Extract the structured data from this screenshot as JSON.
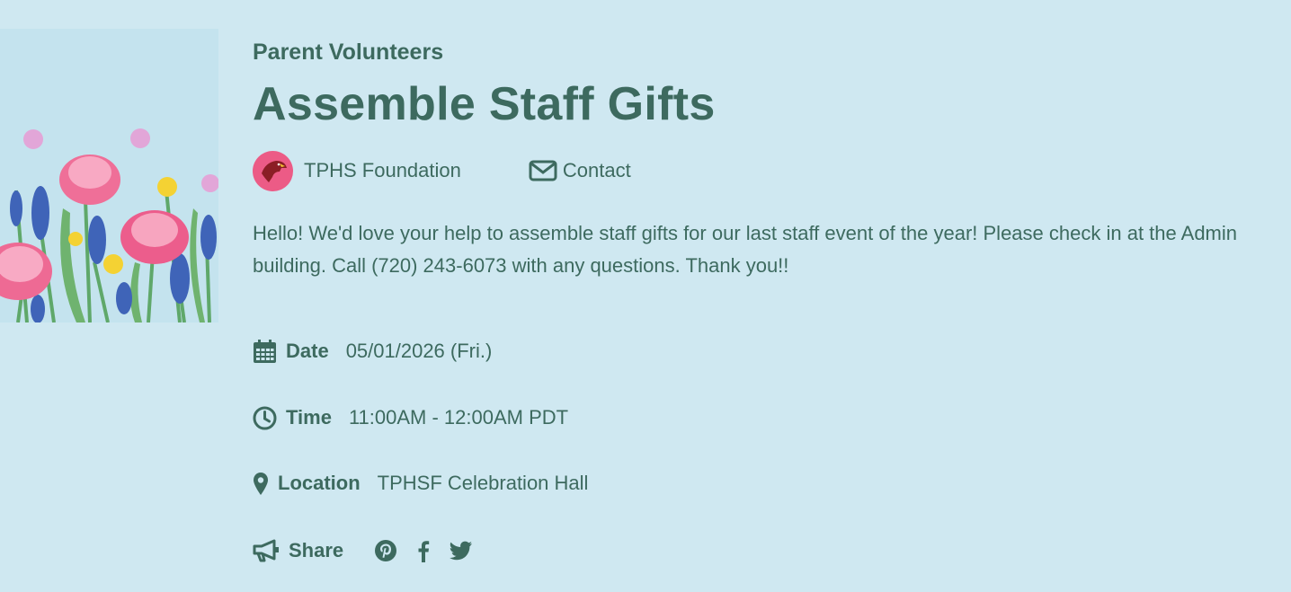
{
  "event": {
    "category": "Parent Volunteers",
    "title": "Assemble Staff Gifts",
    "organizer": "TPHS Foundation",
    "contact_label": "Contact",
    "description": "Hello! We'd love your help to assemble staff gifts for our last staff event of the year! Please check in at the Admin building. Call (720) 243-6073 with any questions. Thank you!!"
  },
  "details": {
    "date": {
      "label": "Date",
      "value": "05/01/2026 (Fri.)",
      "icon": "calendar-icon"
    },
    "time": {
      "label": "Time",
      "value": "11:00AM - 12:00AM PDT",
      "icon": "clock-icon"
    },
    "location": {
      "label": "Location",
      "value": "TPHSF Celebration Hall",
      "icon": "map-pin-icon"
    }
  },
  "share": {
    "label": "Share",
    "icon": "megaphone-icon",
    "networks": [
      "pinterest-icon",
      "facebook-icon",
      "twitter-icon"
    ]
  },
  "colors": {
    "background": "#cfe8f1",
    "text": "#3d6a5f",
    "avatar": "#ec5b86"
  }
}
